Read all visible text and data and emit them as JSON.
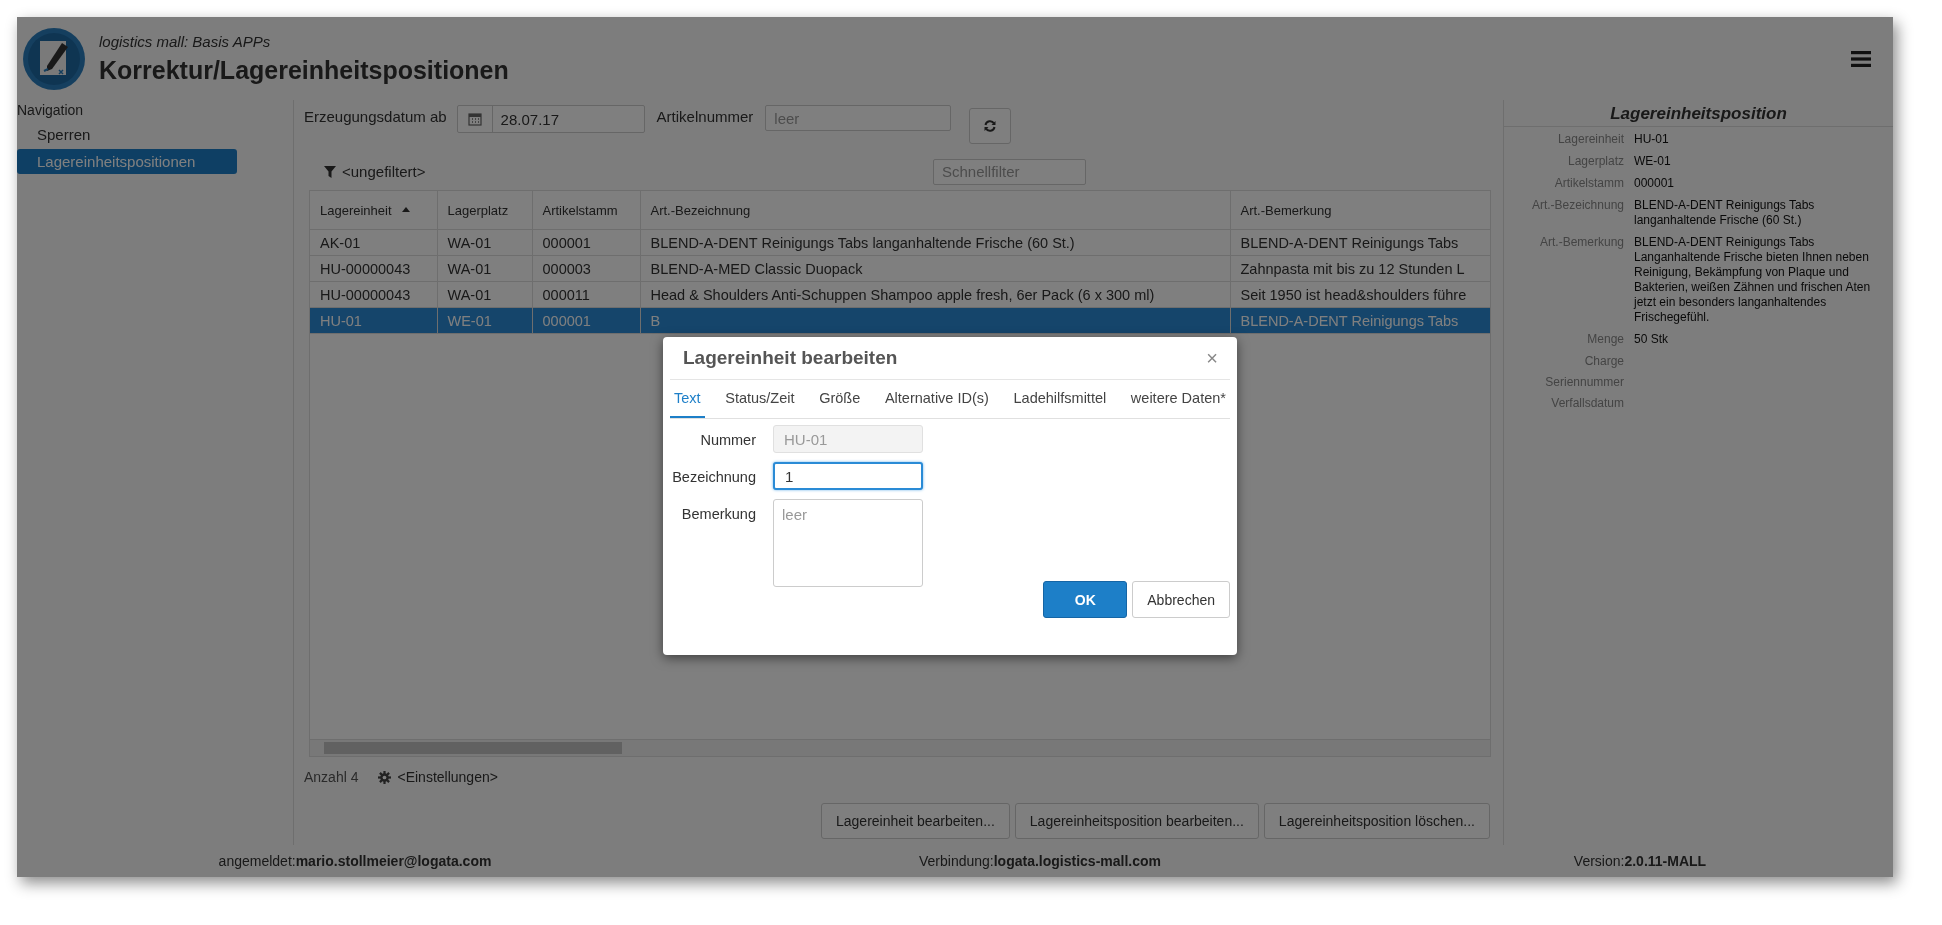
{
  "app": {
    "subtitle": "logistics mall: Basis APPs",
    "title": "Korrektur/Lagereinheitspositionen"
  },
  "navigation": {
    "heading": "Navigation",
    "items": [
      {
        "label": "Sperren",
        "selected": false
      },
      {
        "label": "Lagereinheitspositionen",
        "selected": true
      }
    ]
  },
  "filters": {
    "date_label": "Erzeugungsdatum ab",
    "date_value": "28.07.17",
    "article_label": "Artikelnummer",
    "article_placeholder": "leer",
    "filter_status": "<ungefiltert>",
    "quick_filter_placeholder": "Schnellfilter"
  },
  "table": {
    "columns": [
      {
        "label": "Lagereinheit",
        "sorted": true
      },
      {
        "label": "Lagerplatz",
        "sorted": false
      },
      {
        "label": "Artikelstamm",
        "sorted": false
      },
      {
        "label": "Art.-Bezeichnung",
        "sorted": false
      },
      {
        "label": "Art.-Bemerkung",
        "sorted": false
      }
    ],
    "rows": [
      {
        "cells": [
          "AK-01",
          "WA-01",
          "000001",
          "BLEND-A-DENT Reinigungs Tabs langanhaltende Frische (60 St.)",
          "BLEND-A-DENT Reinigungs Tabs"
        ],
        "selected": false
      },
      {
        "cells": [
          "HU-00000043",
          "WA-01",
          "000003",
          "BLEND-A-MED Classic Duopack",
          "Zahnpasta mit bis zu 12 Stunden L"
        ],
        "selected": false
      },
      {
        "cells": [
          "HU-00000043",
          "WA-01",
          "000011",
          "Head & Shoulders Anti-Schuppen Shampoo apple fresh, 6er Pack (6 x 300 ml)",
          "Seit 1950 ist head&shoulders führe"
        ],
        "selected": false
      },
      {
        "cells": [
          "HU-01",
          "WE-01",
          "000001",
          "B",
          "BLEND-A-DENT Reinigungs Tabs"
        ],
        "selected": true
      }
    ]
  },
  "table_footer": {
    "count": "Anzahl 4",
    "settings": "<Einstellungen>"
  },
  "actions": [
    "Lagereinheit bearbeiten...",
    "Lagereinheitsposition bearbeiten...",
    "Lagereinheitsposition löschen..."
  ],
  "details": {
    "title": "Lagereinheitsposition",
    "fields": [
      {
        "label": "Lagereinheit",
        "value": "HU-01"
      },
      {
        "label": "Lagerplatz",
        "value": "WE-01"
      },
      {
        "label": "Artikelstamm",
        "value": "000001"
      },
      {
        "label": "Art.-Bezeichnung",
        "value": "BLEND-A-DENT Reinigungs Tabs\nlanganhaltende Frische (60 St.)"
      },
      {
        "label": "Art.-Bemerkung",
        "value": "BLEND-A-DENT Reinigungs Tabs\nLanganhaltende Frische bieten Ihnen neben\nReinigung, Bekämpfung von Plaque und\nBakterien, weißen Zähnen und frischen Aten\njetzt ein besonders langanhaltendes\nFrischegefühl."
      },
      {
        "label": "Menge",
        "value": "50 Stk"
      },
      {
        "label": "Charge"
      },
      {
        "label": "Seriennummer"
      },
      {
        "label": "Verfallsdatum"
      }
    ]
  },
  "status_bar": {
    "user": "angemeldet:**mario.stollmeier@logata.com**",
    "connection": "Verbindung:**logata.logistics-mall.com**",
    "version": "Version:**2.0.11-MALL**"
  },
  "dialog": {
    "title": "Lagereinheit bearbeiten",
    "close": "×",
    "tabs": [
      {
        "label": "Text",
        "selected": true
      },
      {
        "label": "Status/Zeit",
        "selected": false
      },
      {
        "label": "Größe",
        "selected": false
      },
      {
        "label": "Alternative ID(s)",
        "selected": false
      },
      {
        "label": "Ladehilfsmittel",
        "selected": false
      },
      {
        "label": "weitere Daten*",
        "selected": false
      }
    ],
    "fields": [
      {
        "label": "Nummer",
        "kind": "input",
        "value": "HU-01",
        "disabled": true,
        "focused": false
      },
      {
        "label": "Bezeichnung",
        "kind": "input",
        "value": "1",
        "disabled": false,
        "focused": true
      },
      {
        "label": "Bemerkung",
        "kind": "textarea",
        "placeholder": "leer",
        "disabled": false,
        "focused": false
      }
    ],
    "buttons": [
      {
        "label": "OK",
        "kind": "primary"
      },
      {
        "label": "Abbrechen",
        "kind": "default"
      }
    ]
  }
}
